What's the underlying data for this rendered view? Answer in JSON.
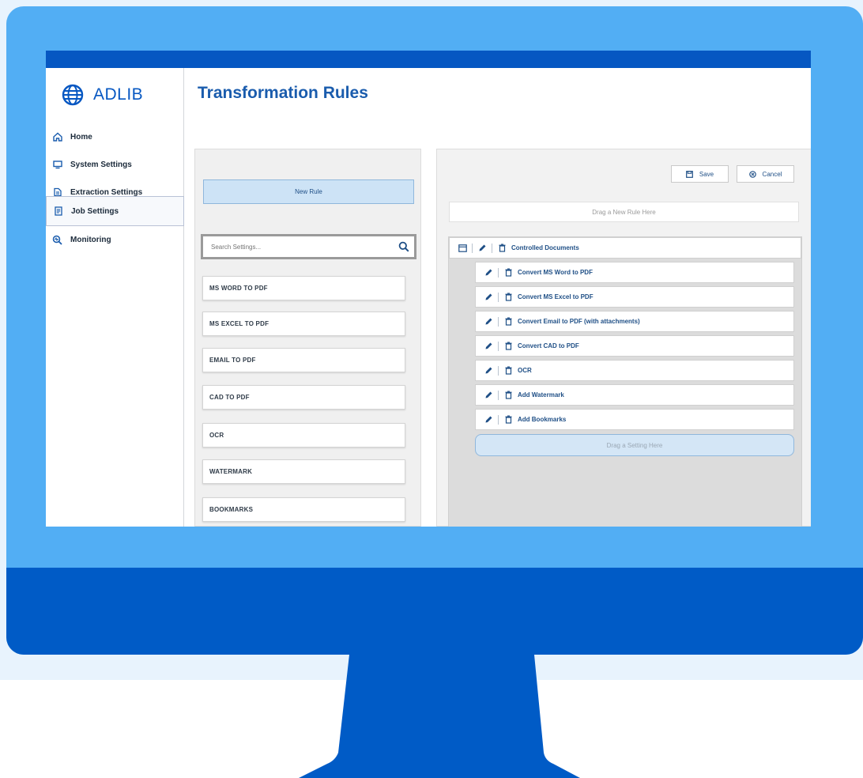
{
  "app": {
    "brand": "ADLIB",
    "page_title": "Transformation Rules"
  },
  "sidebar": {
    "items": [
      {
        "label": "Home",
        "icon": "home-icon"
      },
      {
        "label": "System Settings",
        "icon": "monitor-icon"
      },
      {
        "label": "Extraction Settings",
        "icon": "extraction-icon"
      },
      {
        "label": "Job Settings",
        "icon": "document-icon",
        "active": true
      },
      {
        "label": "Monitoring",
        "icon": "monitoring-icon"
      }
    ]
  },
  "left_panel": {
    "new_rule_label": "New Rule",
    "search_placeholder": "Search Settings...",
    "settings": [
      "MS WORD TO PDF",
      "MS EXCEL TO PDF",
      "EMAIL TO PDF",
      "CAD TO PDF",
      "OCR",
      "WATERMARK",
      "BOOKMARKS"
    ]
  },
  "right_panel": {
    "save_label": "Save",
    "cancel_label": "Cancel",
    "drop_rule_label": "Drag a New Rule Here",
    "rule": {
      "label": "Controlled Documents"
    },
    "rule_steps": [
      "Convert MS Word to PDF",
      "Convert MS Excel to PDF",
      "Convert Email to PDF (with attachments)",
      "Convert CAD to PDF",
      "OCR",
      "Add Watermark",
      "Add Bookmarks"
    ],
    "drop_setting_label": "Drag a Setting Here"
  },
  "colors": {
    "brand_blue": "#0657c2",
    "monitor_light": "#52aef4",
    "monitor_dark": "#005bc6",
    "accent_light": "#cde3f6"
  }
}
